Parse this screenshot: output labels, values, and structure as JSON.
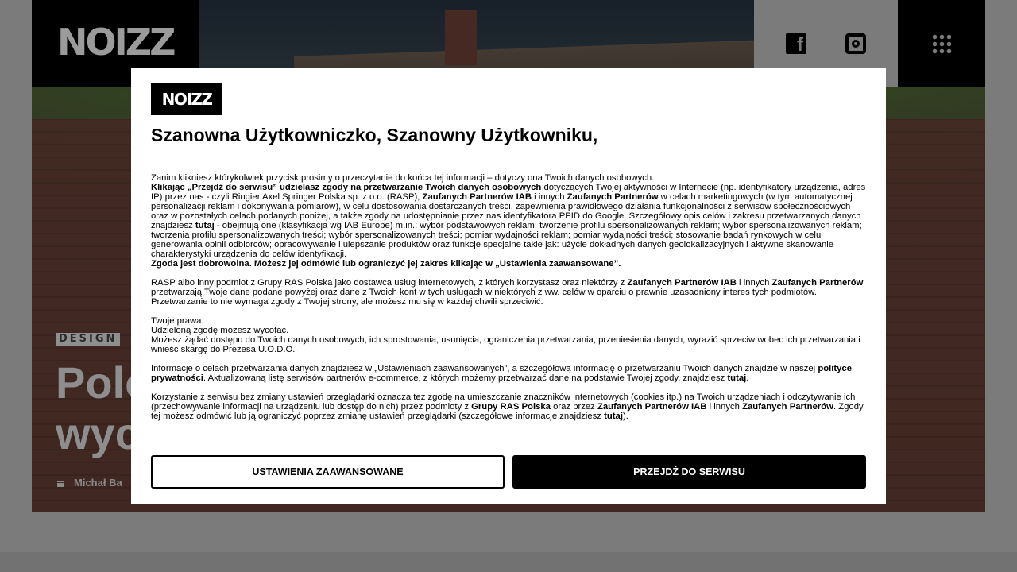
{
  "header": {
    "logo_text": "NOIZZ",
    "social": [
      "facebook-icon",
      "instagram-icon"
    ],
    "menu_icon": "grid-menu-icon"
  },
  "article": {
    "category": "DESIGN",
    "headline_fragment_1": "Polo",
    "headline_fragment_2": "wyc",
    "author": "Michał Ba"
  },
  "consent": {
    "logo_text": "NOIZZ",
    "title": "Szanowna Użytkowniczko, Szanowny Użytkowniku,",
    "p1_intro": "Zanim klikniesz którykolwiek przycisk prosimy o przeczytanie do końca tej informacji – dotyczy ona Twoich danych osobowych.",
    "p1_bold_1": "Klikając „Przejdź do serwisu” udzielasz zgody na przetwarzanie Twoich danych osobowych",
    "p1_text_2": " dotyczących Twojej aktywności w Internecie (np. identyfikatory urządzenia, adres IP) przez nas - czyli Ringier Axel Springer Polska sp. z o.o. (RASP), ",
    "p1_bold_2": "Zaufanych Partnerów IAB",
    "p1_text_3": " i innych ",
    "p1_bold_3": "Zaufanych Partnerów",
    "p1_text_4": " w celach marketingowych (w tym automatycznej personalizacji reklam i dokonywania pomiarów), w celu dostosowania dostarczanych treści, zapewnienia prawidłowego działania funkcjonalności z serwisów społecznościowych oraz w pozostałych celach podanych poniżej, a także zgody na udostępnianie przez nas identyfikatora PPID do Google. Szczegółowy opis celów i zakresu przetwarzanych danych znajdziesz ",
    "p1_bold_4": "tutaj",
    "p1_text_5": " - obejmują one (klasyfikacja wg IAB Europe) m.in.: wybór podstawowych reklam; tworzenie profilu spersonalizowanych reklam; wybór spersonalizowanych reklam; tworzenia profilu spersonalizowanych treści; wybór spersonalizowanych treści; pomiar wydajności reklam; pomiar wydajności treści; stosowanie badań rynkowych w celu generowania opinii odbiorców; opracowywanie i ulepszanie produktów oraz funkcje specjalne takie jak: użycie dokładnych danych geolokalizacyjnych i aktywne skanowanie charakterystyki urządzenia do celów identyfikacji.",
    "p1_bold_5": "Zgoda jest dobrowolna. Możesz jej odmówić lub ograniczyć jej zakres klikając w „Ustawienia zaawansowane”.",
    "p2_text_1": "RASP albo inny podmiot z Grupy RAS Polska jako dostawca usług internetowych, z których korzystasz oraz niektórzy z ",
    "p2_bold_1": "Zaufanych Partnerów IAB",
    "p2_text_2": " i innych ",
    "p2_bold_2": "Zaufanych Partnerów",
    "p2_text_3": " przetwarzają Twoje dane podane powyżej oraz dane z Twoich kont w tych usługach w niektórych z ww. celów w oparciu o prawnie uzasadniony interes tych podmiotów. Przetwarzanie to nie wymaga zgody z Twojej strony, ale możesz mu się w każdej chwili sprzeciwić.",
    "p3_line1": "Twoje prawa:",
    "p3_line2": "Udzieloną zgodę możesz wycofać.",
    "p3_line3": "Możesz żądać dostępu do Twoich danych osobowych, ich sprostowania, usunięcia, ograniczenia przetwarzania, przeniesienia danych, wyrazić sprzeciw wobec ich przetwarzania i wnieść skargę do Prezesa U.O.D.O.",
    "p4_text_1": "Informacje o celach przetwarzania danych znajdziesz w „Ustawieniach zaawansowanych”, a szczegółową informację o przetwarzaniu Twoich danych znajdzie w naszej ",
    "p4_bold_1": "polityce prywatności",
    "p4_text_2": ". Aktualizowaną listę serwisów partnerów e-commerce, z których możemy przetwarzać dane na podstawie Twojej zgody, znajdziesz ",
    "p4_bold_2": "tutaj",
    "p4_text_3": ".",
    "p5_text_1": "Korzystanie z serwisu bez zmiany ustawień przeglądarki oznacza też zgodę na umieszczanie znaczników internetowych (cookies itp.) na Twoich urządzeniach i odczytywanie ich (przechowywanie informacji na urządzeniu lub dostęp do nich) przez podmioty z ",
    "p5_bold_1": "Grupy RAS Polska",
    "p5_text_2": " oraz przez ",
    "p5_bold_2": "Zaufanych Partnerów IAB",
    "p5_text_3": " i innych ",
    "p5_bold_3": "Zaufanych Partnerów",
    "p5_text_4": ". Zgody tej możesz odmówić lub ją ograniczyć poprzez zmianę ustawień przeglądarki (szczegółowe informacje znajdziesz ",
    "p5_bold_4": "tutaj",
    "p5_text_5": ").",
    "btn_settings": "USTAWIENIA ZAAWANSOWANE",
    "btn_continue": "PRZEJDŹ DO SERWISU"
  }
}
